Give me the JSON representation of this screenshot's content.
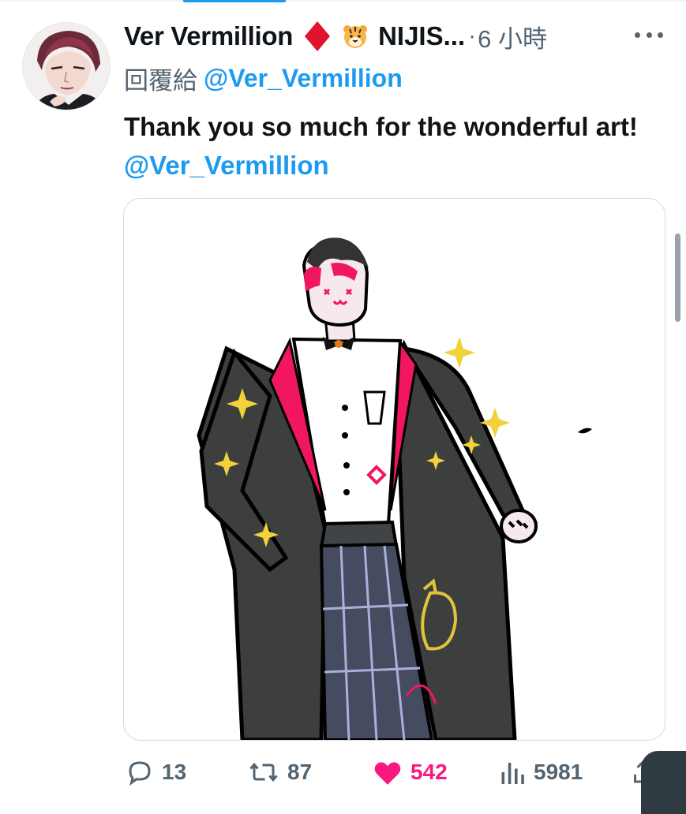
{
  "tweet": {
    "display_name": "Ver Vermillion",
    "affiliation_truncated": "NIJIS...",
    "separator": "·",
    "time_ago": "6 小時",
    "reply_prefix": "回覆給",
    "reply_handle": "@Ver_Vermillion",
    "text_before_mention": "Thank you so much for the wonderful art! ",
    "text_mention": "@Ver_Vermillion"
  },
  "actions": {
    "replies": "13",
    "retweets": "87",
    "likes": "542",
    "views": "5981"
  },
  "icons": {
    "badge_1": "red-diamond-emoji-icon",
    "badge_2": "tiger-face-emoji-icon",
    "more": "more-dots-icon",
    "reply": "reply-bubble-icon",
    "retweet": "retweet-icon",
    "like": "heart-filled-icon",
    "views": "analytics-bars-icon",
    "share": "share-icon"
  },
  "colors": {
    "accent_blue": "#1d9bf0",
    "like_pink": "#f91880",
    "muted_gray": "#536471",
    "text_dark": "#0f1419"
  }
}
